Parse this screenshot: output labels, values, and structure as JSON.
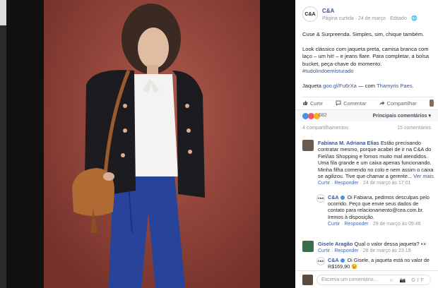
{
  "post": {
    "page_name": "C&A",
    "logo_text": "C&A",
    "meta": "Página curtida · 24 de março · Editado · 🌐",
    "headline": "Cuse & Surpreenda. Simples, sim, chique também.",
    "body": "Look clássico com jaqueta preta, camisa branca com laço – um hit! – e jeans flare. Para completar, a bolsa bucket, peça-chave do momento.",
    "hashtag": "#tudolindoemisturado",
    "link_prefix": "Jaqueta ",
    "link_url": "goo.gl/Fu6rXa",
    "with_text": " — com ",
    "with_person": "Thamyris Paes."
  },
  "actions": {
    "like": "Curtir",
    "comment": "Comentar",
    "share": "Compartilhar"
  },
  "reactions": {
    "count": "682",
    "sort": "Principais comentários ▾",
    "colors": [
      "#4a90e2",
      "#f25268",
      "#f7b125"
    ]
  },
  "stats": {
    "shares": "4 compartilhamentos",
    "comments": "15 comentários"
  },
  "comments": [
    {
      "author": "Fabiana M. Adriana Elias",
      "text": " Estão precisando contratar mesmo, porque acabei de ir na C&A do Fiel/ias Shopping e fomos muito mal atendidos. Uma fila grande e um caixa apenas funcionando. Minha filha comendo no colo e nem assim o caixa se agilizou. Tive que chamar a gerente... ",
      "more": "Ver mais",
      "foot_like": "Curtir",
      "foot_reply": "Responder",
      "foot_date": "24 de março às 17:01"
    },
    {
      "author": "Gisele Aragão",
      "text": " Qual o valor dessa jaqueta? 👀",
      "foot_like": "Curtir",
      "foot_reply": "Responder",
      "foot_date": "28 de março às 23:19"
    }
  ],
  "replies": [
    {
      "author": "C&A",
      "text": " Oi Fabiana, pedimos desculpas pelo ocorrido. Peço que envie seus dados de contato para relacionamento@cea.com.br. Iremos à disposição.",
      "foot_like": "Curtir",
      "foot_reply": "Responder",
      "foot_date": "29 de março às 09:46"
    },
    {
      "author": "C&A",
      "text": " Oi Gisele, a jaqueta está no valor de R$169,90 😉"
    }
  ],
  "composer": {
    "placeholder": "Escreva um comentário...",
    "icons": "☺ 📷 GIF"
  }
}
